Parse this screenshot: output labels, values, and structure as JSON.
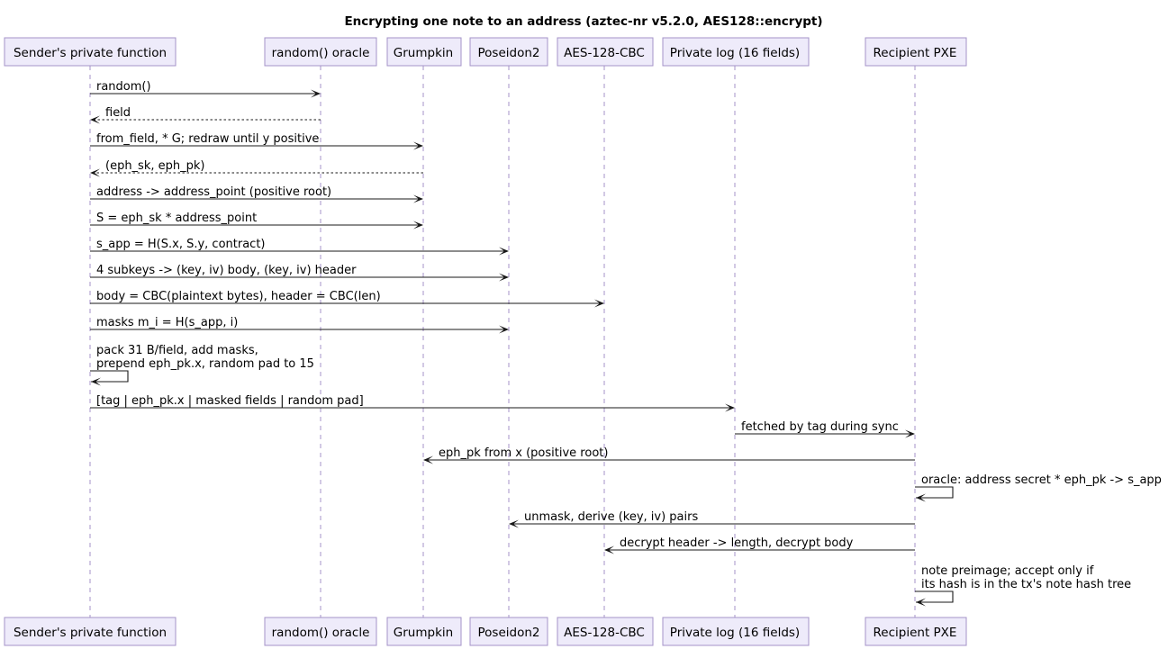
{
  "title": "Encrypting one note to an address (aztec-nr v5.2.0, AES128::encrypt)",
  "participants": [
    "Sender's private function",
    "random() oracle",
    "Grumpkin",
    "Poseidon2",
    "AES-128-CBC",
    "Private log (16 fields)",
    "Recipient PXE"
  ],
  "messages": [
    {
      "from": 0,
      "to": 1,
      "lines": [
        "random()"
      ],
      "style": "solid"
    },
    {
      "from": 1,
      "to": 0,
      "lines": [
        "field"
      ],
      "style": "dashed"
    },
    {
      "from": 0,
      "to": 2,
      "lines": [
        "from_field, * G; redraw until y positive"
      ],
      "style": "solid"
    },
    {
      "from": 2,
      "to": 0,
      "lines": [
        "(eph_sk, eph_pk)"
      ],
      "style": "dashed"
    },
    {
      "from": 0,
      "to": 2,
      "lines": [
        "address -> address_point (positive root)"
      ],
      "style": "solid"
    },
    {
      "from": 0,
      "to": 2,
      "lines": [
        "S = eph_sk * address_point"
      ],
      "style": "solid"
    },
    {
      "from": 0,
      "to": 3,
      "lines": [
        "s_app = H(S.x, S.y, contract)"
      ],
      "style": "solid"
    },
    {
      "from": 0,
      "to": 3,
      "lines": [
        "4 subkeys -> (key, iv) body, (key, iv) header"
      ],
      "style": "solid"
    },
    {
      "from": 0,
      "to": 4,
      "lines": [
        "body = CBC(plaintext bytes), header = CBC(len)"
      ],
      "style": "solid"
    },
    {
      "from": 0,
      "to": 3,
      "lines": [
        "masks m_i = H(s_app, i)"
      ],
      "style": "solid"
    },
    {
      "from": 0,
      "to": 0,
      "lines": [
        "pack 31 B/field, add masks,",
        "prepend eph_pk.x, random pad to 15"
      ],
      "style": "solid"
    },
    {
      "from": 0,
      "to": 5,
      "lines": [
        "[tag | eph_pk.x | masked fields | random pad]"
      ],
      "style": "solid"
    },
    {
      "from": 5,
      "to": 6,
      "lines": [
        "fetched by tag during sync"
      ],
      "style": "solid"
    },
    {
      "from": 6,
      "to": 2,
      "lines": [
        "eph_pk from x (positive root)"
      ],
      "style": "solid"
    },
    {
      "from": 6,
      "to": 6,
      "lines": [
        "oracle: address secret * eph_pk -> s_app"
      ],
      "style": "solid"
    },
    {
      "from": 6,
      "to": 3,
      "lines": [
        "unmask, derive (key, iv) pairs"
      ],
      "style": "solid"
    },
    {
      "from": 6,
      "to": 4,
      "lines": [
        "decrypt header -> length, decrypt body"
      ],
      "style": "solid"
    },
    {
      "from": 6,
      "to": 6,
      "lines": [
        "note preimage; accept only if",
        "its hash is in the tx's note hash tree"
      ],
      "style": "solid"
    }
  ]
}
